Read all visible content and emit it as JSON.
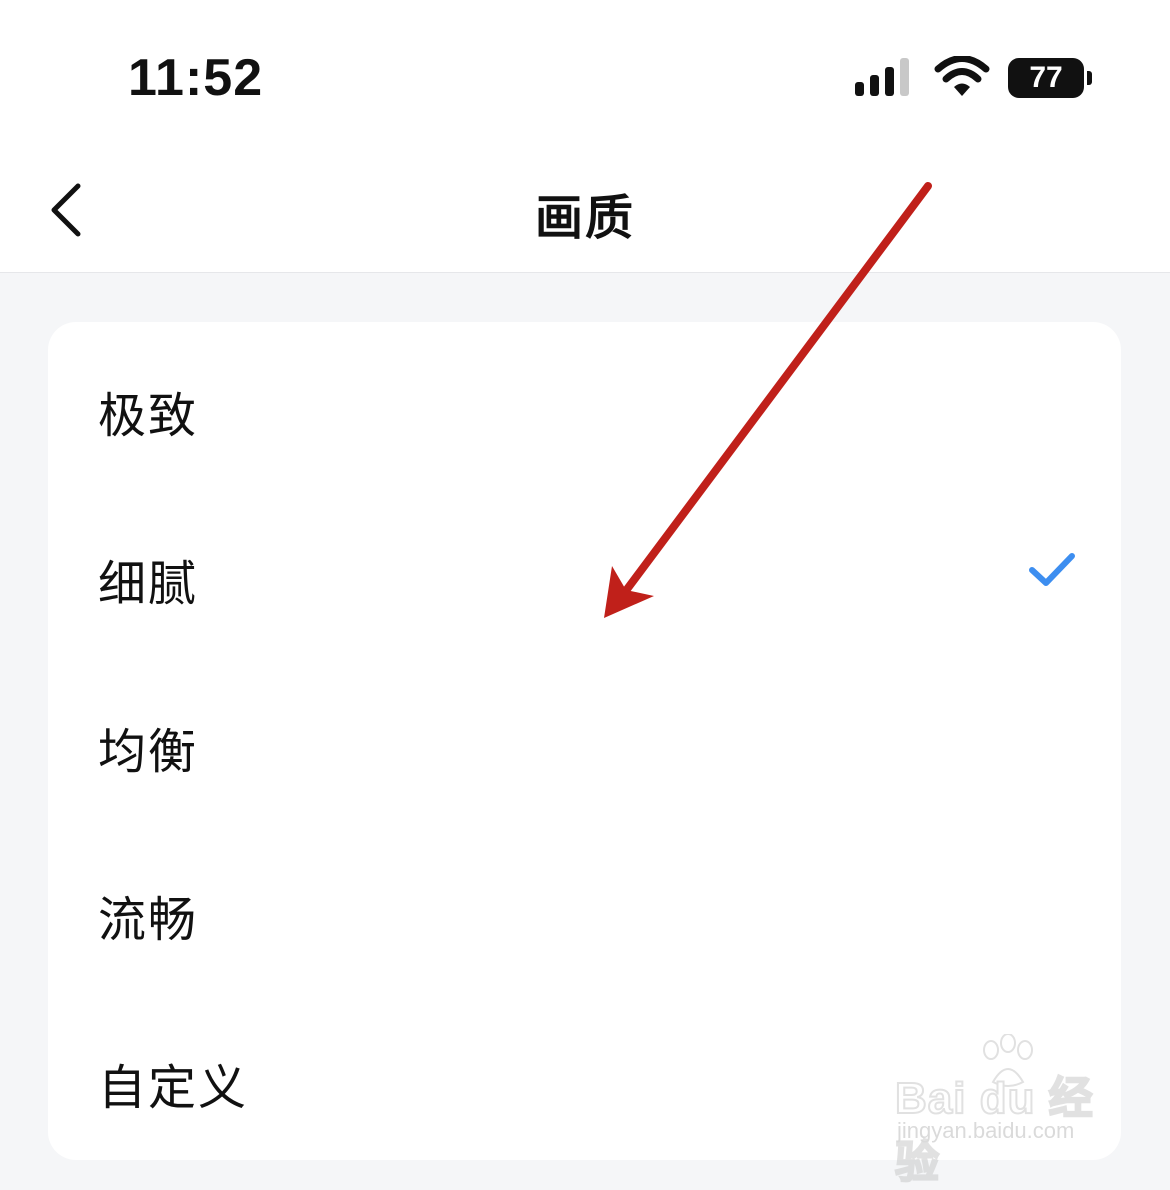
{
  "status_bar": {
    "time": "11:52",
    "battery_level": "77",
    "icons": [
      "signal-icon",
      "wifi-icon",
      "battery-icon"
    ]
  },
  "nav": {
    "title": "画质",
    "back_icon": "chevron-left-icon"
  },
  "options": [
    {
      "label": "极致",
      "selected": false
    },
    {
      "label": "细腻",
      "selected": true
    },
    {
      "label": "均衡",
      "selected": false
    },
    {
      "label": "流畅",
      "selected": false
    },
    {
      "label": "自定义",
      "selected": false
    }
  ],
  "colors": {
    "accent": "#3d8ef0",
    "annotation_arrow": "#c0201a",
    "page_background": "#f5f6f8"
  },
  "watermark": {
    "brand": "Bai du 经验",
    "url": "jingyan.baidu.com"
  }
}
